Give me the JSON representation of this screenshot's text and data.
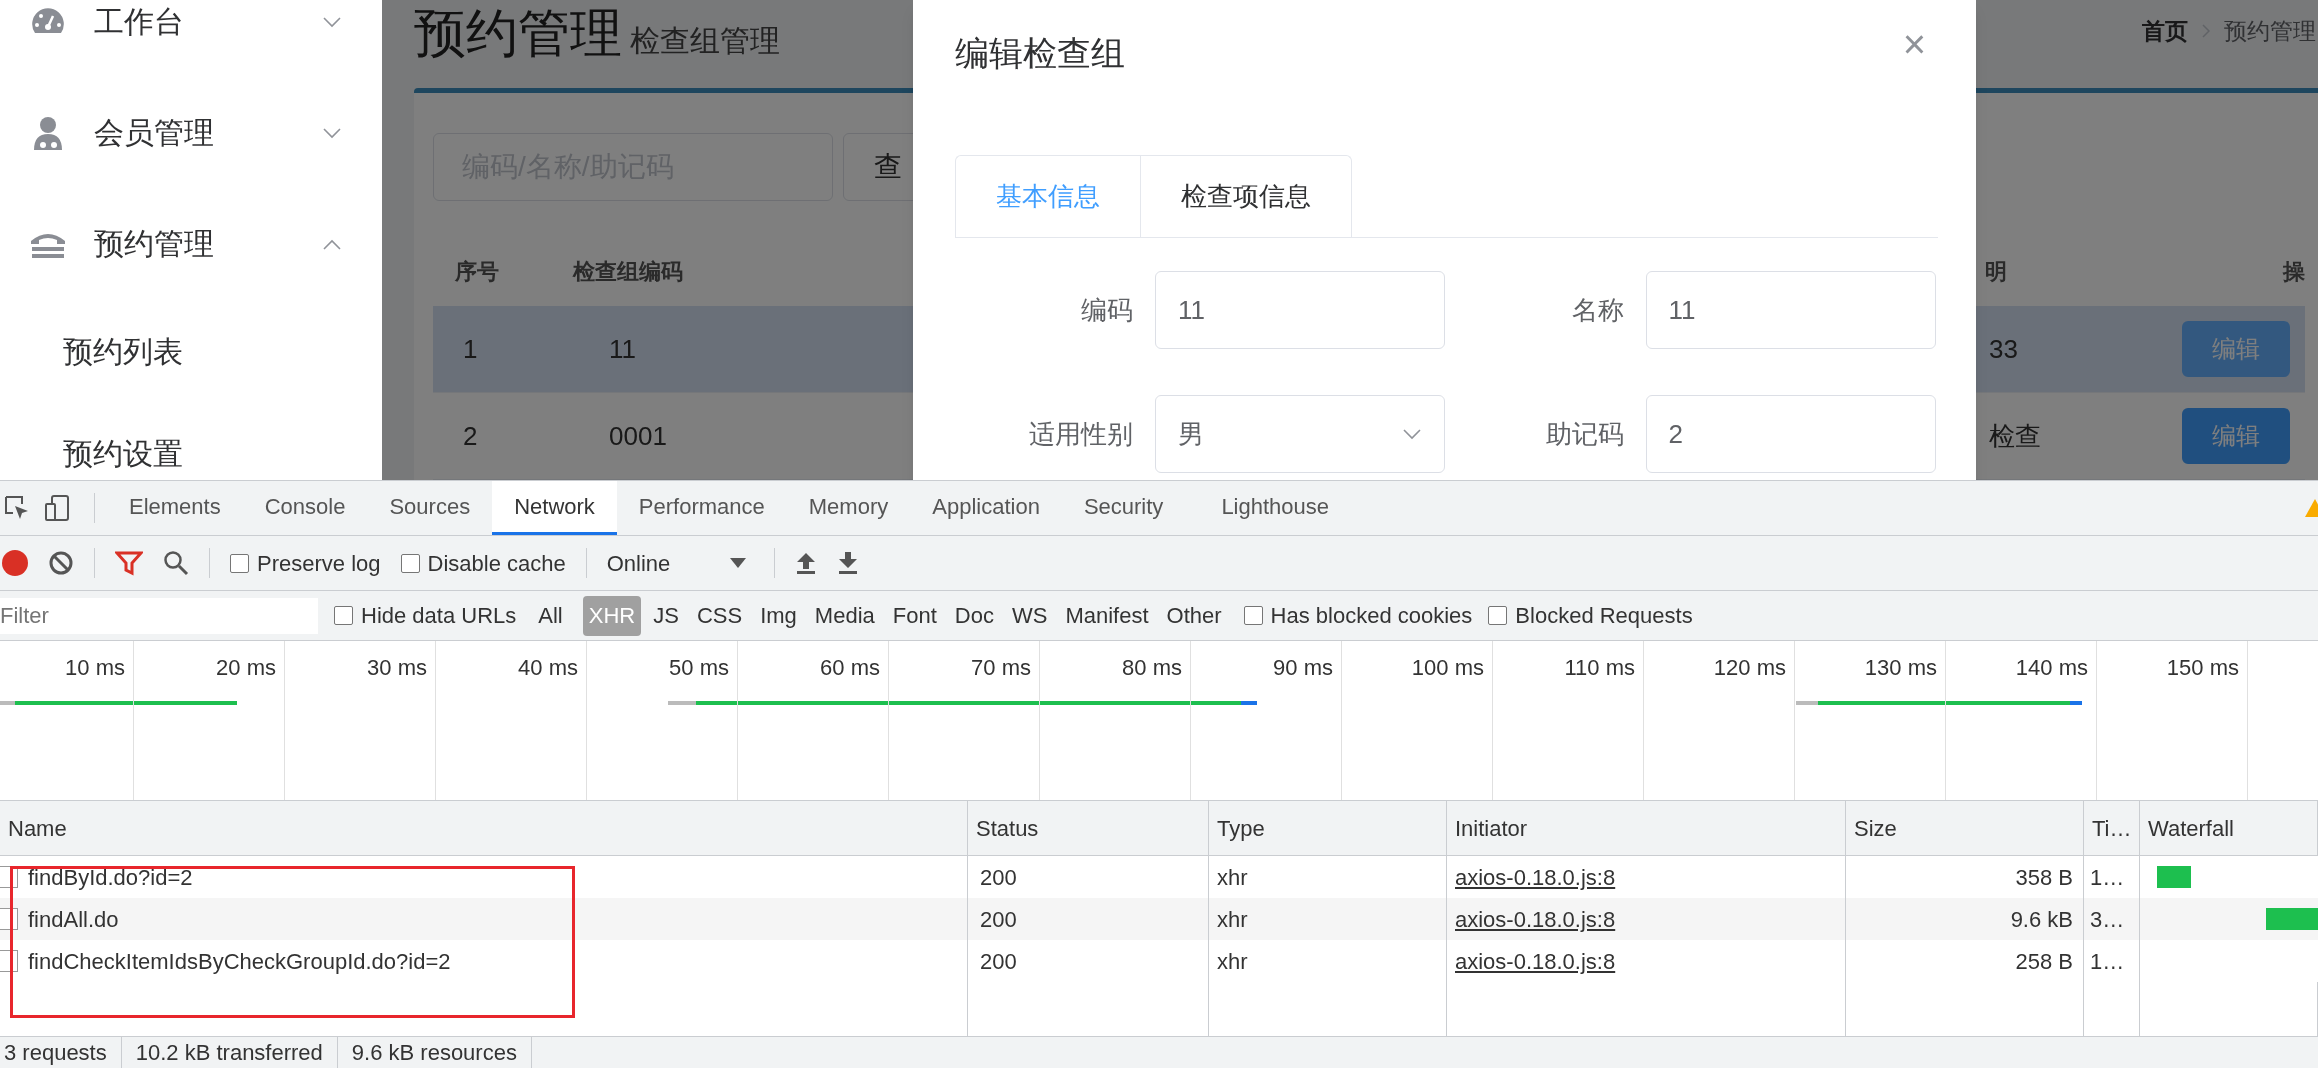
{
  "sidebar": {
    "items": [
      {
        "label": "工作台",
        "kind": "gauge",
        "expanded": false
      },
      {
        "label": "会员管理",
        "kind": "user",
        "expanded": false
      },
      {
        "label": "预约管理",
        "kind": "phone",
        "expanded": true,
        "children": [
          {
            "label": "预约列表"
          },
          {
            "label": "预约设置"
          }
        ]
      }
    ]
  },
  "page": {
    "title": "预约管理",
    "subtitle": "检查组管理",
    "breadcrumb": [
      "首页",
      "预约管理"
    ],
    "search": {
      "placeholder": "编码/名称/助记码",
      "button": "查"
    },
    "table": {
      "columns": [
        "序号",
        "检查组编码",
        "明",
        "操"
      ],
      "rows": [
        {
          "cells": [
            "1",
            "11",
            "33"
          ],
          "action": "编辑",
          "hovered": true
        },
        {
          "cells": [
            "2",
            "0001",
            "检查"
          ],
          "action": "编辑",
          "hovered": false
        }
      ]
    }
  },
  "dialog": {
    "title": "编辑检查组",
    "close": "×",
    "tabs": [
      {
        "label": "基本信息",
        "selected": true
      },
      {
        "label": "检查项信息",
        "selected": false
      }
    ],
    "fields": [
      {
        "label": "编码",
        "value": "11",
        "kind": "text"
      },
      {
        "label": "名称",
        "value": "11",
        "kind": "text"
      },
      {
        "label": "适用性别",
        "value": "男",
        "kind": "select"
      },
      {
        "label": "助记码",
        "value": "2",
        "kind": "text"
      }
    ]
  },
  "devtools": {
    "tabs": [
      {
        "label": "Elements",
        "selected": false
      },
      {
        "label": "Console",
        "selected": false
      },
      {
        "label": "Sources",
        "selected": false
      },
      {
        "label": "Network",
        "selected": true
      },
      {
        "label": "Performance",
        "selected": false
      },
      {
        "label": "Memory",
        "selected": false
      },
      {
        "label": "Application",
        "selected": false
      },
      {
        "label": "Security",
        "selected": false
      },
      {
        "label": "Lighthouse",
        "selected": false
      }
    ],
    "toolbar": {
      "recording": true,
      "preserve_log": {
        "label": "Preserve log",
        "checked": false
      },
      "disable_cache": {
        "label": "Disable cache",
        "checked": false
      },
      "throttling": "Online"
    },
    "filter": {
      "placeholder": "Filter",
      "hide_data_urls": {
        "label": "Hide data URLs",
        "checked": false
      },
      "types": [
        {
          "label": "All",
          "selected": false
        },
        {
          "label": "XHR",
          "selected": true
        },
        {
          "label": "JS",
          "selected": false
        },
        {
          "label": "CSS",
          "selected": false
        },
        {
          "label": "Img",
          "selected": false
        },
        {
          "label": "Media",
          "selected": false
        },
        {
          "label": "Font",
          "selected": false
        },
        {
          "label": "Doc",
          "selected": false
        },
        {
          "label": "WS",
          "selected": false
        },
        {
          "label": "Manifest",
          "selected": false
        },
        {
          "label": "Other",
          "selected": false
        }
      ],
      "blocked_cookies": {
        "label": "Has blocked cookies",
        "checked": false
      },
      "blocked_requests": {
        "label": "Blocked Requests",
        "checked": false
      }
    },
    "timeline": [
      "10 ms",
      "20 ms",
      "30 ms",
      "40 ms",
      "50 ms",
      "60 ms",
      "70 ms",
      "80 ms",
      "90 ms",
      "100 ms",
      "110 ms",
      "120 ms",
      "130 ms",
      "140 ms",
      "150 ms"
    ],
    "table": {
      "columns": [
        "Name",
        "Status",
        "Type",
        "Initiator",
        "Size",
        "Ti…",
        "Waterfall"
      ],
      "rows": [
        {
          "name": "findById.do?id=2",
          "status": "200",
          "type": "xhr",
          "initiator": "axios-0.18.0.js:8",
          "size": "358 B",
          "time": "1…"
        },
        {
          "name": "findAll.do",
          "status": "200",
          "type": "xhr",
          "initiator": "axios-0.18.0.js:8",
          "size": "9.6 kB",
          "time": "3…"
        },
        {
          "name": "findCheckItemIdsByCheckGroupId.do?id=2",
          "status": "200",
          "type": "xhr",
          "initiator": "axios-0.18.0.js:8",
          "size": "258 B",
          "time": "1…"
        }
      ]
    },
    "status_bar": [
      "3 requests",
      "10.2 kB transferred",
      "9.6 kB resources"
    ]
  }
}
